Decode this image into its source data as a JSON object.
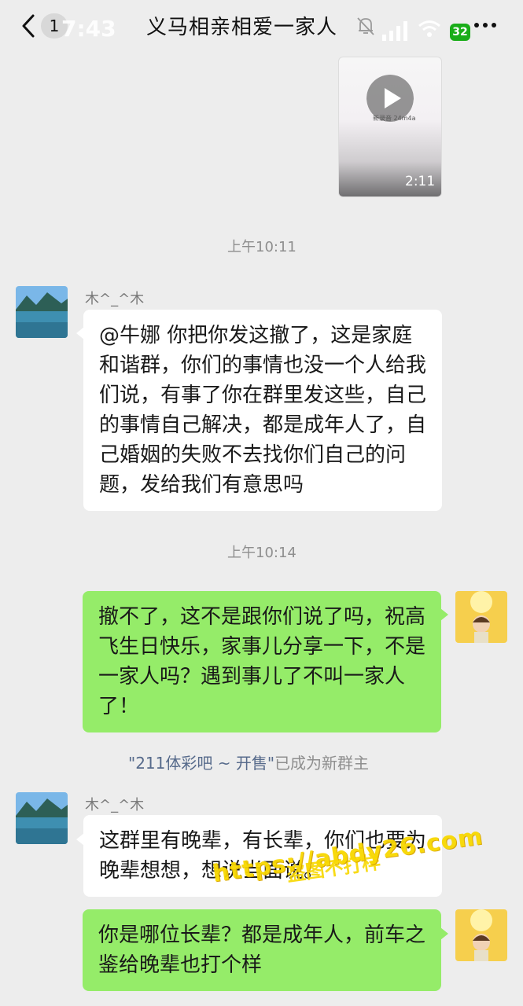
{
  "header": {
    "back_count": "1",
    "status_time": "7:43",
    "title": "义马相亲相爱一家人",
    "battery": "32"
  },
  "video": {
    "label": "新录音 24m4a",
    "duration": "2:11"
  },
  "messages": [
    {
      "time": "上午10:11"
    },
    {
      "sender": "木^_^木",
      "text": "@牛娜  你把你发这撤了，这是家庭和谐群，你们的事情也没一个人给我们说，有事了你在群里发这些，自己的事情自己解决，都是成年人了，自己婚姻的失败不去找你们自己的问题，发给我们有意思吗"
    },
    {
      "time": "上午10:14"
    },
    {
      "self": "撤不了，这不是跟你们说了吗，祝高飞生日快乐，家事儿分享一下，不是一家人吗？遇到事儿了不叫一家人了！"
    },
    {
      "system_highlight": "\"211体彩吧 ~ 开售\"",
      "system_rest": "已成为新群主"
    },
    {
      "sender": "木^_^木",
      "text": "这群里有晚辈，有长辈，你们也要为晚辈想想，想说当面说。"
    },
    {
      "self": "你是哪位长辈？都是成年人，前车之鉴给晚辈也打个样"
    }
  ],
  "watermark": {
    "url": "https://abdy26.com",
    "text": "盗图不打样"
  }
}
